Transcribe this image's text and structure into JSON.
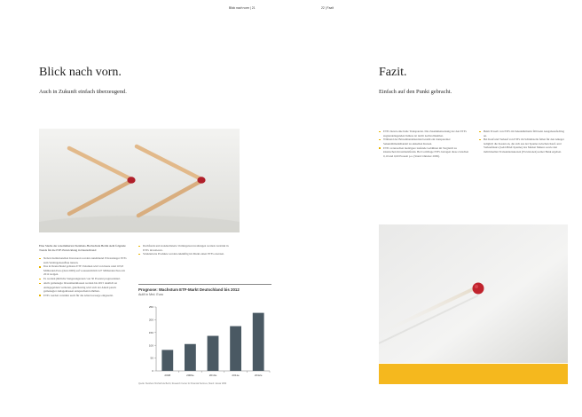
{
  "header": {
    "left": "Blick nach vorn | 21",
    "right": "22 | Fazit"
  },
  "left_page": {
    "title": "Blick nach vorn.",
    "subtitle": "Auch in Zukunft einfach überzeugend.",
    "intro": "Eine Studie der renommierten Steinbeis-Hochschule Berlin sieht folgende Trends für die ETF-Entwicklung in Deutschland:",
    "bullets_col1": [
      "Neben institutionellen Investoren werden zunehmend Privatanleger ETFs zum Vermögensaufbau nutzen.",
      "Das in Deutschland gelistete ETF-Volumen wird von heute rund 103,8 Milliarden Euro (Juni 2009) auf voraussichtlich 227 Milliarden Euro im 2012 steigen.",
      "Es werden jährliche Steigerungsraten von 30 Prozent prognostiziert.",
      "Aktiv gemanagte Investmentklassen werden bis 2015 deutlich an Anlagegeldern verlieren, gleichzeitig wird sich der Anteil passiv gemanagter Anlageklassen entsprechend erhöhen.",
      "ETFs werden verstärkt auch für die Altersvorsorge eingesetzt."
    ],
    "bullets_col2": [
      "Dachfonds und standardisierte Vermögensverwaltungen werden verstärkt in ETFs investieren.",
      "Strukturierte Produkte werden zukünftig im Markt einen ETFs ersetzen."
    ]
  },
  "right_page": {
    "title": "Fazit.",
    "subtitle": "Einfach auf den Punkt gebracht.",
    "bullets_col1": [
      "ETFs bieten eine hohe Transparenz. Die Zusammensetzung der den ETFs zugrundeliegenden Indizes ist leicht nachvollziehbar.",
      "Während der Börsenhandelszeiten besteht ein transparenter Sekundärmarkthandel zu aktuellen Kursen.",
      "ETFs verursachen niedrigere laufende Gebühren im Vergleich zu klassischen Investmentfonds. Bei ComStage ETFs betragen diese zwischen 0,10 und 0,60 Prozent p.a. (Stand: Oktober 2009)."
    ],
    "bullets_col2": [
      "Beim Erwerb von ETFs im Sekundärmarkt fällt kein Ausgabeaufschlag an.",
      "Bei Kauf und Verkauf von ETFs im Schnittstelle fallen für den Anleger lediglich die Kosten an, die sich aus der Spanne zwischen Kauf- und Verkaufskurs (Geld-Brief-Spanne) des Market Makers sowie den individuellen Transaktionskosten (Provisionen) seiner Bank ergeben."
    ]
  },
  "chart_data": {
    "type": "bar",
    "title": "Prognose: Wachstum ETF-Markt Deutschland bis 2012",
    "subtitle": "AuM in Mrd. Euro",
    "categories": [
      "2008",
      "2009e",
      "2010e",
      "2011e",
      "2012e"
    ],
    "values": [
      82,
      105,
      137,
      175,
      227
    ],
    "ylim": [
      0,
      250
    ],
    "yticks": [
      0,
      50,
      100,
      150,
      200,
      250
    ],
    "bar_color": "#4a5963",
    "grid": false,
    "source": "Quelle: Steinbeis Hochschule Berlin; Research Center for Financial Services, Stand: Januar 2009"
  },
  "colors": {
    "accent_yellow": "#f5b81e",
    "bullet": "#e8b400",
    "bar": "#4a5963"
  }
}
